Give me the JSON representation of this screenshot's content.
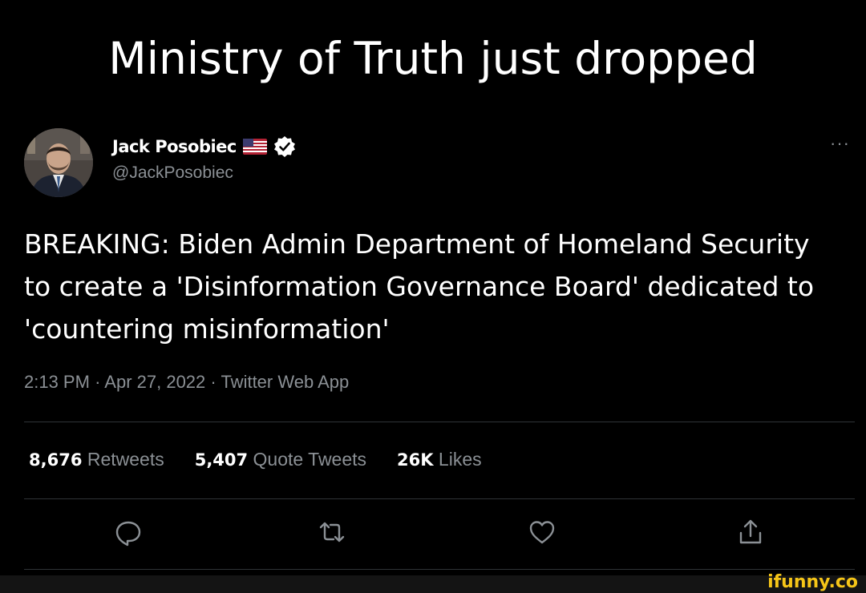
{
  "caption": "Ministry of Truth just dropped",
  "tweet": {
    "display_name": "Jack Posobiec",
    "flag_icon": "us-flag-icon",
    "verified_icon": "verified-badge-icon",
    "handle": "@JackPosobiec",
    "more_label": "···",
    "text": "BREAKING: Biden Admin Department of Homeland Security to create a 'Disinformation Governance Board' dedicated to 'countering misinformation'",
    "time": "2:13 PM",
    "date": "Apr 27, 2022",
    "source": "Twitter Web App",
    "separator": "·"
  },
  "stats": {
    "retweets_count": "8,676",
    "retweets_label": "Retweets",
    "quotes_count": "5,407",
    "quotes_label": "Quote Tweets",
    "likes_count": "26K",
    "likes_label": "Likes"
  },
  "actions": [
    {
      "icon": "reply-icon"
    },
    {
      "icon": "retweet-icon"
    },
    {
      "icon": "like-heart-icon"
    },
    {
      "icon": "share-icon"
    }
  ],
  "watermark": "ifunny.co",
  "colors": {
    "background": "#000000",
    "text": "#ffffff",
    "muted": "#8b9095",
    "divider": "#2f3336",
    "verified": "#ffffff",
    "watermark": "#f5c518"
  }
}
